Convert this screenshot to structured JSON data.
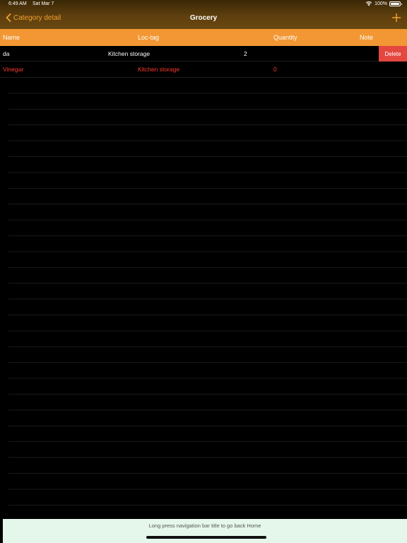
{
  "status_bar": {
    "time": "6:49 AM",
    "date": "Sat Mar 7",
    "battery": "100%"
  },
  "nav": {
    "back_label": "Category detail",
    "title": "Grocery",
    "accent_color": "#f0a02e"
  },
  "columns": {
    "name": "Name",
    "loc_tag": "Loc-tag",
    "quantity": "Quantity",
    "note": "Note"
  },
  "rows": [
    {
      "name": "da",
      "loc_tag": "Kitchen storage",
      "quantity": "2",
      "note": "",
      "action": "Delete"
    },
    {
      "name": "Vinegar",
      "loc_tag": "Kitchen storage",
      "quantity": "0",
      "note": ""
    }
  ],
  "footer": {
    "hint": "Long press navigation bar title to go back Home"
  }
}
